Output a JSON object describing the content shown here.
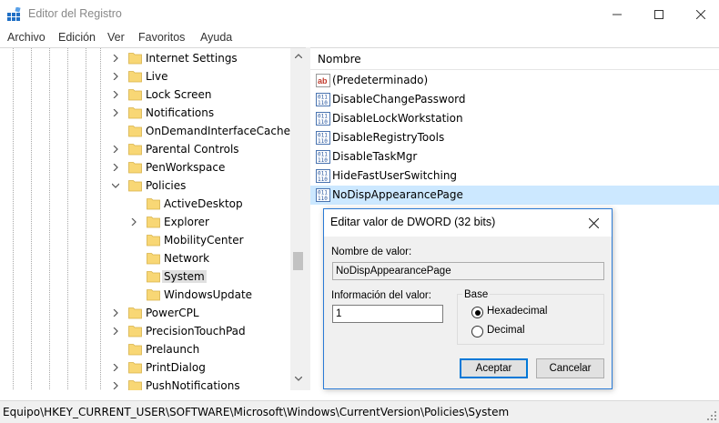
{
  "window": {
    "title": "Editor del Registro"
  },
  "menu": [
    "Archivo",
    "Edición",
    "Ver",
    "Favoritos",
    "Ayuda"
  ],
  "tree": {
    "items": [
      {
        "label": "Internet Settings",
        "expander": "collapsed"
      },
      {
        "label": "Live",
        "expander": "collapsed"
      },
      {
        "label": "Lock Screen",
        "expander": "collapsed"
      },
      {
        "label": "Notifications",
        "expander": "collapsed"
      },
      {
        "label": "OnDemandInterfaceCache",
        "expander": "none"
      },
      {
        "label": "Parental Controls",
        "expander": "collapsed"
      },
      {
        "label": "PenWorkspace",
        "expander": "collapsed"
      },
      {
        "label": "Policies",
        "expander": "expanded"
      },
      {
        "label": "ActiveDesktop",
        "expander": "none"
      },
      {
        "label": "Explorer",
        "expander": "collapsed"
      },
      {
        "label": "MobilityCenter",
        "expander": "none"
      },
      {
        "label": "Network",
        "expander": "none"
      },
      {
        "label": "System",
        "expander": "none",
        "selected": true
      },
      {
        "label": "WindowsUpdate",
        "expander": "none"
      },
      {
        "label": "PowerCPL",
        "expander": "collapsed"
      },
      {
        "label": "PrecisionTouchPad",
        "expander": "collapsed"
      },
      {
        "label": "Prelaunch",
        "expander": "none"
      },
      {
        "label": "PrintDialog",
        "expander": "collapsed"
      },
      {
        "label": "PushNotifications",
        "expander": "collapsed"
      }
    ]
  },
  "list": {
    "column_name": "Nombre",
    "rows": [
      {
        "name": "(Predeterminado)",
        "type": "string"
      },
      {
        "name": "DisableChangePassword",
        "type": "dword"
      },
      {
        "name": "DisableLockWorkstation",
        "type": "dword"
      },
      {
        "name": "DisableRegistryTools",
        "type": "dword"
      },
      {
        "name": "DisableTaskMgr",
        "type": "dword"
      },
      {
        "name": "HideFastUserSwitching",
        "type": "dword"
      },
      {
        "name": "NoDispAppearancePage",
        "type": "dword",
        "selected": true
      }
    ]
  },
  "status": {
    "path": "Equipo\\HKEY_CURRENT_USER\\SOFTWARE\\Microsoft\\Windows\\CurrentVersion\\Policies\\System"
  },
  "dialog": {
    "title": "Editar valor de DWORD (32 bits)",
    "name_label": "Nombre de valor:",
    "name_value": "NoDispAppearancePage",
    "data_label": "Información del valor:",
    "data_value": "1",
    "base_label": "Base",
    "base_options": [
      "Hexadecimal",
      "Decimal"
    ],
    "base_selected": "Hexadecimal",
    "ok_label": "Aceptar",
    "cancel_label": "Cancelar"
  },
  "colors": {
    "selection": "#cce8ff",
    "dialog_border": "#2b7bd6",
    "folder": "#f8d775"
  }
}
